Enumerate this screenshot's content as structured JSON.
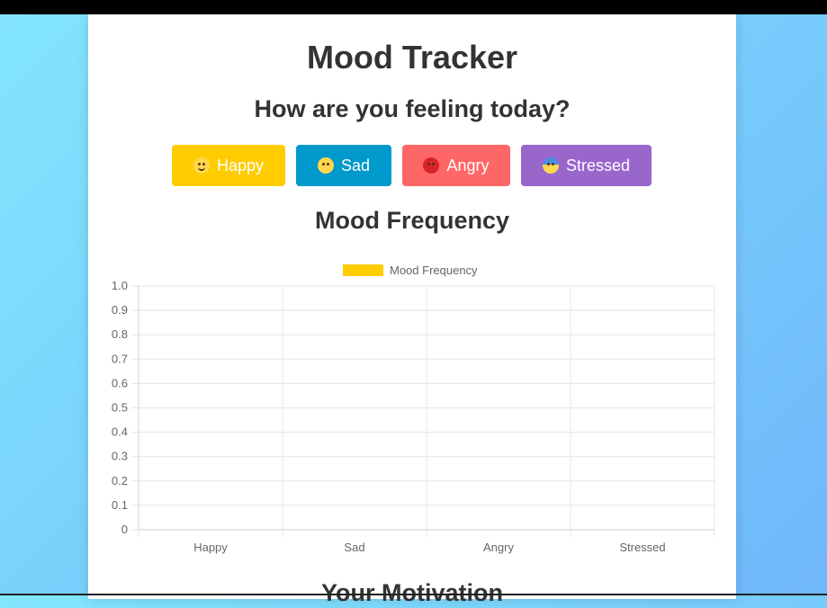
{
  "app": {
    "title": "Mood Tracker",
    "question": "How are you feeling today?",
    "chart_heading": "Mood Frequency",
    "motivation_heading": "Your Motivation"
  },
  "buttons": [
    {
      "label": "Happy",
      "color": "#ffcc00",
      "icon": "smiling-face-icon"
    },
    {
      "label": "Sad",
      "color": "#0099cc",
      "icon": "flushed-face-icon"
    },
    {
      "label": "Angry",
      "color": "#ff6666",
      "icon": "angry-face-icon"
    },
    {
      "label": "Stressed",
      "color": "#9966cc",
      "icon": "fearful-face-icon"
    }
  ],
  "chart_data": {
    "type": "bar",
    "categories": [
      "Happy",
      "Sad",
      "Angry",
      "Stressed"
    ],
    "series": [
      {
        "name": "Mood Frequency",
        "values": [
          0,
          0,
          0,
          0
        ],
        "color": "#ffcc00"
      }
    ],
    "ylim": [
      0,
      1.0
    ],
    "yticks": [
      "1.0",
      "0.9",
      "0.8",
      "0.7",
      "0.6",
      "0.5",
      "0.4",
      "0.3",
      "0.2",
      "0.1",
      "0"
    ],
    "grid": true,
    "legend": "top-center"
  }
}
